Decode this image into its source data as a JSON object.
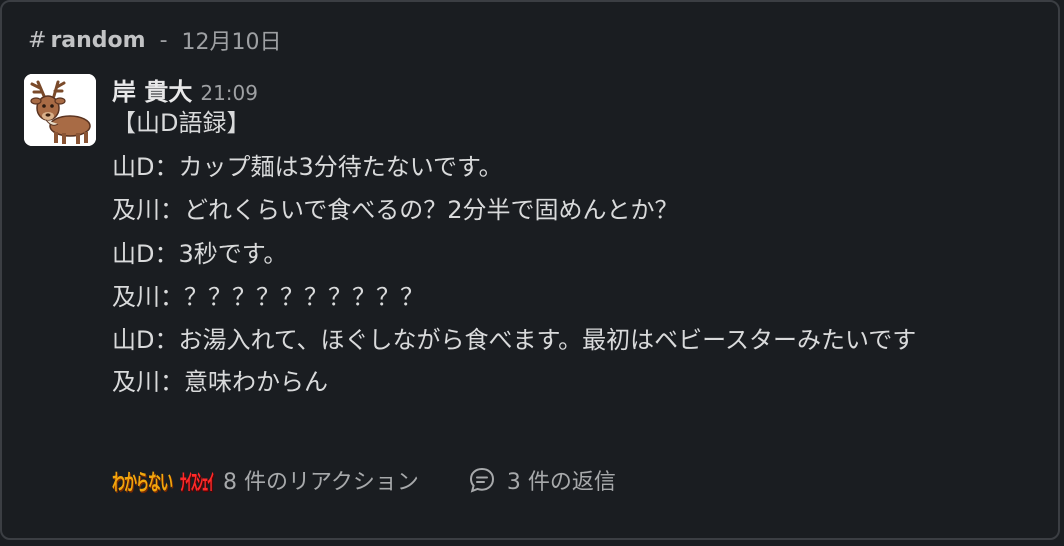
{
  "header": {
    "hash": "#",
    "channel": "random",
    "separator": "-",
    "date": "12月10日"
  },
  "message": {
    "author": "岸 貴大",
    "time": "21:09",
    "lines": [
      "【山D語録】",
      "山D：カップ麺は3分待たないです。",
      "及川：どれくらいで食べるの？2分半で固めんとか？",
      "山D：3秒です。",
      "及川：？？？？？？？？？？",
      "山D：お湯入れて、ほぐしながら食べます。最初はベビースターみたいです",
      "及川：意味わからん"
    ]
  },
  "footer": {
    "stamp1": "わからない",
    "stamp2": "ﾅｲｽｼｪｲ",
    "reactions_label": "8 件のリアクション",
    "replies_label": "3 件の返信",
    "reply_icon": "comment-icon"
  },
  "colors": {
    "background": "#1a1d21",
    "border": "#3b3e43",
    "text": "#d9dadb",
    "muted": "#9ea0a3",
    "stamp1": "#f2a60d",
    "stamp2": "#ff2a2a"
  },
  "avatar_icon": "reindeer-avatar"
}
